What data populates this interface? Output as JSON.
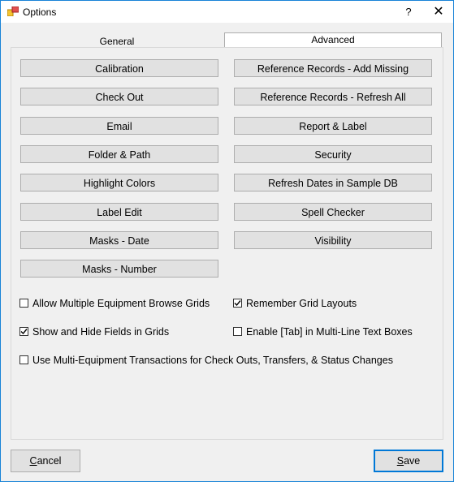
{
  "window": {
    "title": "Options",
    "help_glyph": "?",
    "close_glyph": "✕"
  },
  "tabs": [
    {
      "label": "General",
      "active": false
    },
    {
      "label": "Advanced",
      "active": true
    }
  ],
  "left_buttons": [
    "Calibration",
    "Check Out",
    "Email",
    "Folder & Path",
    "Highlight Colors",
    "Label Edit",
    "Masks - Date",
    "Masks - Number"
  ],
  "right_buttons": [
    "Reference Records - Add Missing",
    "Reference Records - Refresh All",
    "Report & Label",
    "Security",
    "Refresh Dates in Sample DB",
    "Spell Checker",
    "Visibility"
  ],
  "checkboxes": [
    {
      "label": "Allow Multiple Equipment Browse Grids",
      "checked": false
    },
    {
      "label": "Remember Grid Layouts",
      "checked": true
    },
    {
      "label": "Show and Hide Fields in Grids",
      "checked": true
    },
    {
      "label": "Enable [Tab] in Multi-Line Text Boxes",
      "checked": false
    },
    {
      "label": "Use Multi-Equipment Transactions for Check Outs, Transfers, & Status Changes",
      "checked": false
    }
  ],
  "footer": {
    "cancel_first": "C",
    "cancel_rest": "ancel",
    "save_first": "S",
    "save_rest": "ave"
  },
  "colors": {
    "window_border": "#1883d7",
    "button_face": "#e1e1e1",
    "default_button_border": "#0078d7"
  },
  "icons": {
    "app": "app-icon",
    "help": "help-icon",
    "close": "close-icon",
    "check": "checkmark-icon"
  }
}
